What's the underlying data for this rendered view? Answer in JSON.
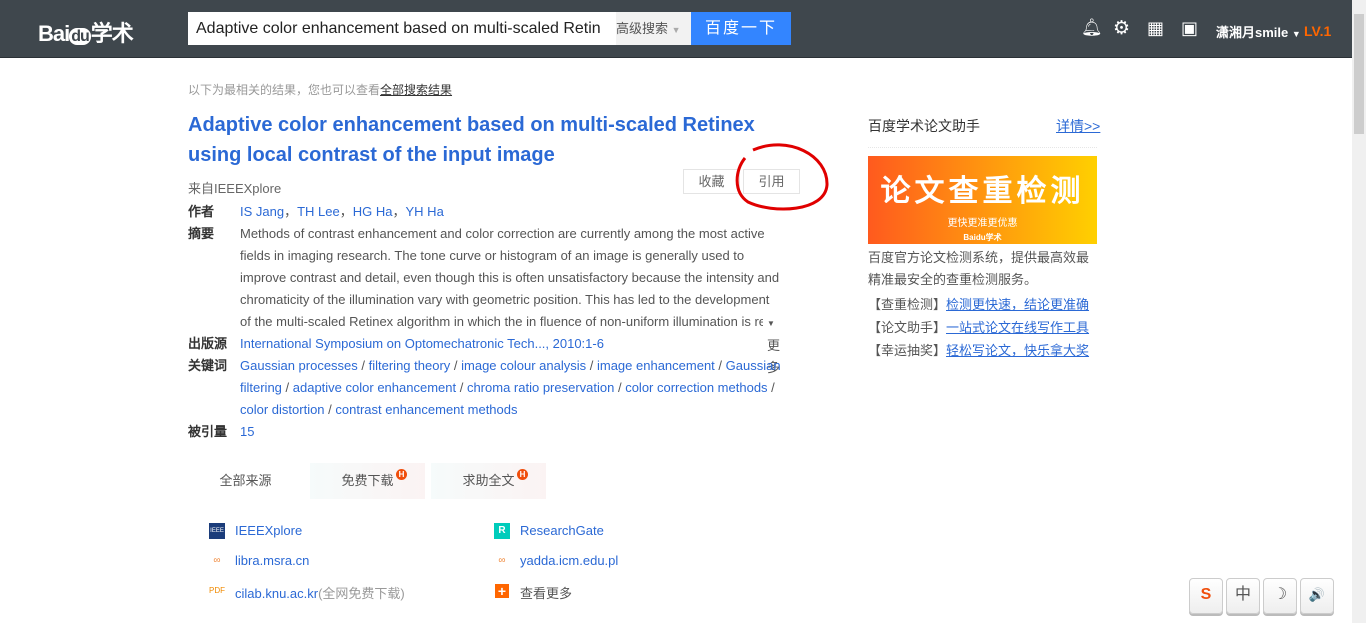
{
  "header": {
    "logo": "Bai du 学术",
    "search_value": "Adaptive color enhancement based on multi-scaled Retinex using local contrast of the input image",
    "advanced": "高级搜索",
    "search_button": "百度一下",
    "username": "潇湘月smile",
    "level": "LV.1"
  },
  "hint": {
    "text": "以下为最相关的结果，您也可以查看",
    "link": "全部搜索结果"
  },
  "paper": {
    "title": "Adaptive color enhancement based on multi-scaled Retinex using local contrast of the input image",
    "source": "来自IEEEXplore",
    "collect": "收藏",
    "cite": "引用",
    "authors_label": "作者",
    "authors": [
      "IS Jang",
      "TH Lee",
      "HG Ha",
      "YH Ha"
    ],
    "abstract_label": "摘要",
    "abstract": "Methods of contrast enhancement and color correction are currently among the most active fields in imaging research. The tone curve or histogram of an image is generally used to improve contrast and detail, even though this is often unsatisfactory because the intensity and chromaticity of the illumination vary with geometric position. This has led to the development of the multi-scaled Retinex algorithm in which the in fluence of non-uniform illumination is re",
    "more": "更多",
    "publisher_label": "出版源",
    "publisher": "International Symposium on Optomechatronic Tech..., 2010:1-6",
    "keywords_label": "关键词",
    "keywords": [
      "Gaussian processes",
      "filtering theory",
      "image colour analysis",
      "image enhancement",
      "Gaussian filtering",
      "adaptive color enhancement",
      "chroma ratio preservation",
      "color correction methods",
      "color distortion",
      "contrast enhancement methods"
    ],
    "cited_label": "被引量",
    "cited": "15"
  },
  "tabs": [
    "全部来源",
    "免费下载",
    "求助全文"
  ],
  "sources": [
    {
      "name": "IEEEXplore",
      "icon": "ieee-icon"
    },
    {
      "name": "ResearchGate",
      "icon": "researchgate-icon"
    },
    {
      "name": "libra.msra.cn",
      "icon": "link-icon"
    },
    {
      "name": "yadda.icm.edu.pl",
      "icon": "link-icon"
    },
    {
      "name": "cilab.knu.ac.kr",
      "extra": "(全网免费下载)",
      "icon": "pdf-icon"
    },
    {
      "name": "查看更多",
      "icon": "plus-icon"
    }
  ],
  "sidebar": {
    "title": "百度学术论文助手",
    "details": "详情>>",
    "banner_title": "论文查重检测",
    "banner_sub": "更快更准更优惠",
    "desc": "百度官方论文检测系统，提供最高效最精准最安全的查重检测服务。",
    "links": [
      {
        "tag": "【查重检测】",
        "text": "检测更快速，结论更准确"
      },
      {
        "tag": "【论文助手】",
        "text": "一站式论文在线写作工具"
      },
      {
        "tag": "【幸运抽奖】",
        "text": "轻松写论文，快乐拿大奖"
      }
    ]
  },
  "ime": [
    "S",
    "中",
    "☽",
    "🔊"
  ],
  "colors": {
    "link": "#2b69d5",
    "header": "#3f474d",
    "button": "#3385ff",
    "annotation": "#e00000"
  }
}
